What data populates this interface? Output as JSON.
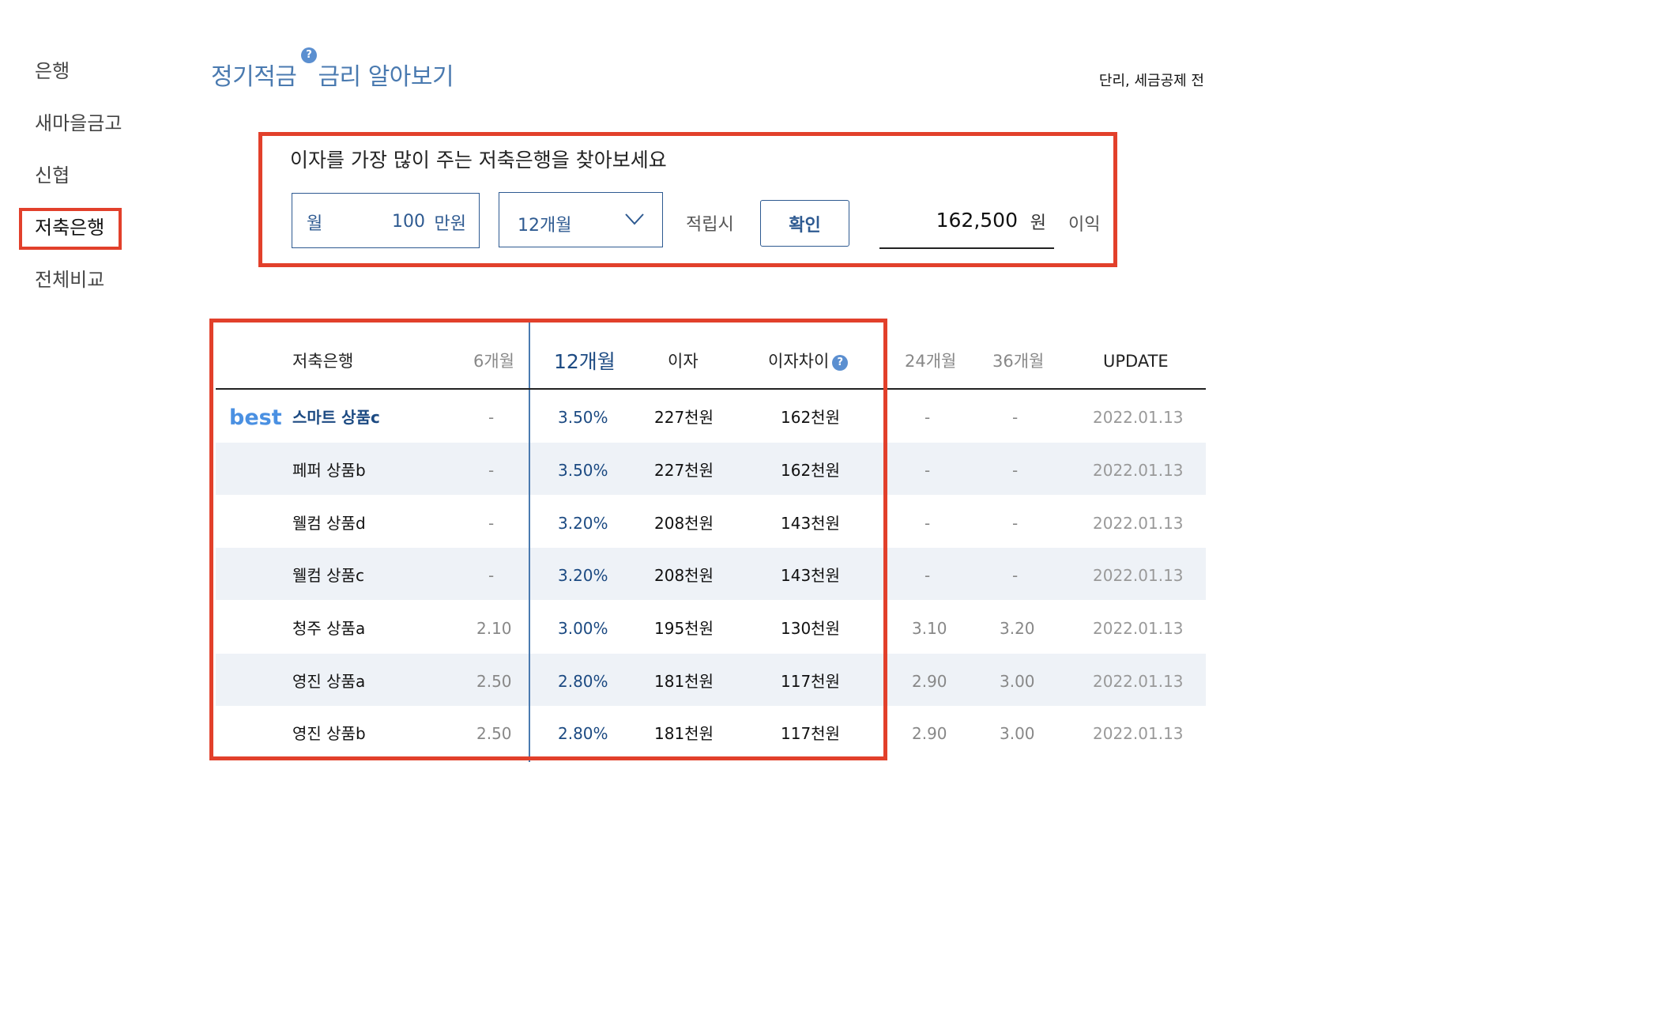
{
  "sidebar": {
    "items": [
      {
        "label": "은행"
      },
      {
        "label": "새마을금고"
      },
      {
        "label": "신협"
      },
      {
        "label": "저축은행"
      },
      {
        "label": "전체비교"
      }
    ]
  },
  "header": {
    "title_part1": "정기적금",
    "title_part2": "금리 알아보기",
    "help_icon": "question-circle-icon",
    "note": "단리, 세금공제 전"
  },
  "calculator": {
    "heading": "이자를 가장 많이 주는 저축은행을 찾아보세요",
    "amount_prefix": "월",
    "amount_value": "100",
    "amount_unit": "만원",
    "period_value": "12개월",
    "save_label": "적립시",
    "confirm_label": "확인",
    "result_value": "162,500",
    "result_unit": "원",
    "profit_label": "이익"
  },
  "table": {
    "headers": {
      "bank": "저축은행",
      "m6": "6개월",
      "m12": "12개월",
      "interest": "이자",
      "diff": "이자차이",
      "m24": "24개월",
      "m36": "36개월",
      "update": "UPDATE"
    },
    "best_label": "best",
    "rows": [
      {
        "name": "스마트 상품c",
        "m6": "-",
        "m12": "3.50%",
        "interest": "227천원",
        "diff": "162천원",
        "m24": "-",
        "m36": "-",
        "update": "2022.01.13"
      },
      {
        "name": "페퍼 상품b",
        "m6": "-",
        "m12": "3.50%",
        "interest": "227천원",
        "diff": "162천원",
        "m24": "-",
        "m36": "-",
        "update": "2022.01.13"
      },
      {
        "name": "웰컴 상품d",
        "m6": "-",
        "m12": "3.20%",
        "interest": "208천원",
        "diff": "143천원",
        "m24": "-",
        "m36": "-",
        "update": "2022.01.13"
      },
      {
        "name": "웰컴 상품c",
        "m6": "-",
        "m12": "3.20%",
        "interest": "208천원",
        "diff": "143천원",
        "m24": "-",
        "m36": "-",
        "update": "2022.01.13"
      },
      {
        "name": "청주 상품a",
        "m6": "2.10",
        "m12": "3.00%",
        "interest": "195천원",
        "diff": "130천원",
        "m24": "3.10",
        "m36": "3.20",
        "update": "2022.01.13"
      },
      {
        "name": "영진 상품a",
        "m6": "2.50",
        "m12": "2.80%",
        "interest": "181천원",
        "diff": "117천원",
        "m24": "2.90",
        "m36": "3.00",
        "update": "2022.01.13"
      },
      {
        "name": "영진 상품b",
        "m6": "2.50",
        "m12": "2.80%",
        "interest": "181천원",
        "diff": "117천원",
        "m24": "2.90",
        "m36": "3.00",
        "update": "2022.01.13"
      }
    ]
  },
  "colors": {
    "accent": "#1c4a82",
    "title": "#4a7ab0",
    "highlight": "#e2402b",
    "row_shade": "#eef2f7",
    "best": "#4a90e2"
  }
}
